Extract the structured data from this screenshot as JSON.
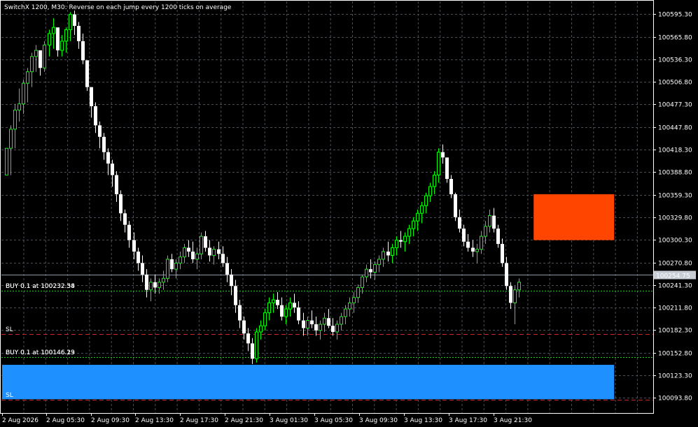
{
  "window": {
    "title": "SwitchX 1200, M30:  Reverse on each jump every 1200 ticks on average"
  },
  "colors": {
    "background": "#000000",
    "grid": "#4a4f55",
    "candle_up": "#00ff00",
    "candle_down": "#ffffff",
    "bid_line": "#8c95a6",
    "order_line": "#1ed21e",
    "sl_line": "#c82828",
    "zone_blue": "#1e90ff",
    "zone_orange": "#ff4500"
  },
  "price_axis": {
    "labels": [
      "100595.30",
      "100565.80",
      "100536.30",
      "100506.80",
      "100477.30",
      "100447.80",
      "100418.30",
      "100388.80",
      "100359.30",
      "100329.80",
      "100300.30",
      "100270.80",
      "100241.30",
      "100211.80",
      "100182.30",
      "100152.80",
      "100123.30",
      "100093.80"
    ],
    "current_price": "100254.75"
  },
  "time_axis": {
    "labels": [
      "2 Aug 2026",
      "2 Aug 05:30",
      "2 Aug 09:30",
      "2 Aug 13:30",
      "2 Aug 17:30",
      "2 Aug 21:30",
      "3 Aug 01:30",
      "3 Aug 05:30",
      "3 Aug 09:30",
      "3 Aug 13:30",
      "3 Aug 17:30",
      "3 Aug 21:30"
    ]
  },
  "trade_lines": [
    {
      "label": "BUY 0.1 at 100232.54",
      "ghost": "BUY 0.1 at 100232.38",
      "price": 100233.5,
      "kind": "order"
    },
    {
      "label": "SL",
      "price": 100177.5,
      "kind": "sl"
    },
    {
      "label": "BUY 0.1 at 100146.23",
      "ghost": "BUY 0.1 at 100146.19",
      "price": 100147.5,
      "kind": "order"
    },
    {
      "label": "SL",
      "price": 100091.5,
      "kind": "sl"
    }
  ],
  "chart_data": {
    "type": "candlestick",
    "title": "SwitchX 1200, M30:  Reverse on each jump every 1200 ticks on average",
    "timeframe": "M30",
    "ylim": [
      100074,
      100612
    ],
    "current_price": 100254.75,
    "zones": [
      {
        "color": "blue",
        "from_bar": 0,
        "to_bar": 143,
        "price_low": 100092,
        "price_high": 100137
      },
      {
        "color": "orange",
        "from_bar": 125,
        "to_bar": 143,
        "price_low": 100300,
        "price_high": 100360
      }
    ],
    "candles": [
      [
        100385,
        100420,
        100385,
        100420
      ],
      [
        100420,
        100450,
        100385,
        100445
      ],
      [
        100445,
        100478,
        100420,
        100470
      ],
      [
        100470,
        100498,
        100455,
        100478
      ],
      [
        100478,
        100510,
        100465,
        100505
      ],
      [
        100505,
        100525,
        100480,
        100520
      ],
      [
        100520,
        100545,
        100500,
        100540
      ],
      [
        100540,
        100555,
        100520,
        100548
      ],
      [
        100548,
        100540,
        100515,
        100525
      ],
      [
        100525,
        100560,
        100520,
        100555
      ],
      [
        100555,
        100575,
        100540,
        100570
      ],
      [
        100570,
        100590,
        100550,
        100578
      ],
      [
        100578,
        100565,
        100540,
        100548
      ],
      [
        100548,
        100568,
        100540,
        100560
      ],
      [
        100560,
        100578,
        100545,
        100575
      ],
      [
        100575,
        100598,
        100560,
        100595
      ],
      [
        100595,
        100600,
        100568,
        100580
      ],
      [
        100580,
        100585,
        100550,
        100560
      ],
      [
        100560,
        100570,
        100530,
        100535
      ],
      [
        100535,
        100525,
        100495,
        100500
      ],
      [
        100500,
        100490,
        100460,
        100475
      ],
      [
        100475,
        100480,
        100440,
        100450
      ],
      [
        100450,
        100455,
        100420,
        100435
      ],
      [
        100435,
        100440,
        100405,
        100415
      ],
      [
        100415,
        100420,
        100385,
        100400
      ],
      [
        100400,
        100405,
        100370,
        100385
      ],
      [
        100385,
        100390,
        100350,
        100360
      ],
      [
        100360,
        100365,
        100325,
        100335
      ],
      [
        100335,
        100340,
        100310,
        100320
      ],
      [
        100320,
        100325,
        100290,
        100300
      ],
      [
        100300,
        100310,
        100275,
        100285
      ],
      [
        100285,
        100290,
        100260,
        100270
      ],
      [
        100270,
        100280,
        100245,
        100255
      ],
      [
        100255,
        100262,
        100225,
        100235
      ],
      [
        100235,
        100250,
        100220,
        100245
      ],
      [
        100245,
        100255,
        100230,
        100238
      ],
      [
        100238,
        100250,
        100230,
        100245
      ],
      [
        100245,
        100260,
        100235,
        100250
      ],
      [
        100250,
        100280,
        100245,
        100275
      ],
      [
        100275,
        100282,
        100258,
        100262
      ],
      [
        100262,
        100275,
        100250,
        100270
      ],
      [
        100270,
        100285,
        100262,
        100278
      ],
      [
        100278,
        100295,
        100270,
        100290
      ],
      [
        100290,
        100300,
        100278,
        100285
      ],
      [
        100285,
        100298,
        100270,
        100275
      ],
      [
        100275,
        100290,
        100262,
        100282
      ],
      [
        100282,
        100310,
        100275,
        100305
      ],
      [
        100305,
        100312,
        100285,
        100290
      ],
      [
        100290,
        100300,
        100272,
        100280
      ],
      [
        100280,
        100292,
        100268,
        100288
      ],
      [
        100288,
        100298,
        100275,
        100282
      ],
      [
        100282,
        100292,
        100265,
        100270
      ],
      [
        100270,
        100278,
        100245,
        100255
      ],
      [
        100255,
        100262,
        100228,
        100240
      ],
      [
        100240,
        100248,
        100205,
        100215
      ],
      [
        100215,
        100222,
        100185,
        100195
      ],
      [
        100195,
        100200,
        100170,
        100178
      ],
      [
        100178,
        100185,
        100155,
        100165
      ],
      [
        100165,
        100172,
        100138,
        100145
      ],
      [
        100145,
        100185,
        100140,
        100180
      ],
      [
        100180,
        100195,
        100170,
        100188
      ],
      [
        100188,
        100210,
        100182,
        100205
      ],
      [
        100205,
        100225,
        100195,
        100218
      ],
      [
        100218,
        100230,
        100205,
        100222
      ],
      [
        100222,
        100232,
        100210,
        100215
      ],
      [
        100215,
        100225,
        100195,
        100200
      ],
      [
        100200,
        100215,
        100190,
        100210
      ],
      [
        100210,
        100225,
        100200,
        100218
      ],
      [
        100218,
        100230,
        100205,
        100212
      ],
      [
        100212,
        100220,
        100190,
        100195
      ],
      [
        100195,
        100205,
        100175,
        100185
      ],
      [
        100185,
        100200,
        100175,
        100195
      ],
      [
        100195,
        100208,
        100185,
        100190
      ],
      [
        100190,
        100200,
        100175,
        100182
      ],
      [
        100182,
        100195,
        100170,
        100190
      ],
      [
        100190,
        100205,
        100180,
        100198
      ],
      [
        100198,
        100210,
        100185,
        100188
      ],
      [
        100188,
        100198,
        100175,
        100180
      ],
      [
        100180,
        100195,
        100170,
        100190
      ],
      [
        100190,
        100205,
        100182,
        100200
      ],
      [
        100200,
        100215,
        100190,
        100210
      ],
      [
        100210,
        100225,
        100200,
        100218
      ],
      [
        100218,
        100232,
        100205,
        100225
      ],
      [
        100225,
        100242,
        100218,
        100238
      ],
      [
        100238,
        100255,
        100230,
        100252
      ],
      [
        100252,
        100268,
        100245,
        100262
      ],
      [
        100262,
        100275,
        100250,
        100258
      ],
      [
        100258,
        100272,
        100248,
        100268
      ],
      [
        100268,
        100280,
        100258,
        100275
      ],
      [
        100275,
        100290,
        100265,
        100285
      ],
      [
        100285,
        100298,
        100272,
        100280
      ],
      [
        100280,
        100295,
        100270,
        100290
      ],
      [
        100290,
        100305,
        100280,
        100300
      ],
      [
        100300,
        100312,
        100290,
        100298
      ],
      [
        100298,
        100310,
        100285,
        100305
      ],
      [
        100305,
        100320,
        100295,
        100315
      ],
      [
        100315,
        100330,
        100305,
        100325
      ],
      [
        100325,
        100340,
        100312,
        100335
      ],
      [
        100335,
        100350,
        100322,
        100345
      ],
      [
        100345,
        100362,
        100335,
        100358
      ],
      [
        100358,
        100375,
        100350,
        100370
      ],
      [
        100370,
        100390,
        100360,
        100385
      ],
      [
        100385,
        100420,
        100375,
        100415
      ],
      [
        100415,
        100425,
        100400,
        100408
      ],
      [
        100408,
        100400,
        100375,
        100380
      ],
      [
        100380,
        100385,
        100355,
        100360
      ],
      [
        100360,
        100362,
        100325,
        100330
      ],
      [
        100330,
        100340,
        100310,
        100315
      ],
      [
        100315,
        100320,
        100292,
        100298
      ],
      [
        100298,
        100308,
        100285,
        100290
      ],
      [
        100290,
        100300,
        100278,
        100285
      ],
      [
        100285,
        100295,
        100270,
        100288
      ],
      [
        100288,
        100312,
        100282,
        100305
      ],
      [
        100305,
        100325,
        100295,
        100318
      ],
      [
        100318,
        100340,
        100310,
        100332
      ],
      [
        100332,
        100342,
        100310,
        100315
      ],
      [
        100315,
        100320,
        100290,
        100295
      ],
      [
        100295,
        100302,
        100265,
        100270
      ],
      [
        100270,
        100278,
        100235,
        100240
      ],
      [
        100240,
        100245,
        100210,
        100218
      ],
      [
        100218,
        100240,
        100190,
        100235
      ],
      [
        100235,
        100250,
        100225,
        100245
      ]
    ]
  }
}
